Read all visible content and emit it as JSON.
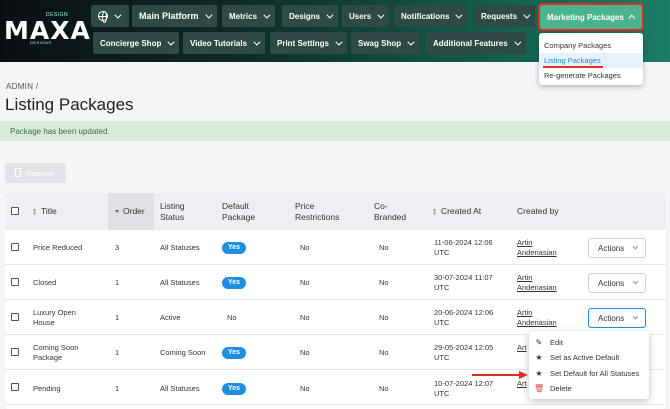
{
  "header": {
    "logo": "MAXA",
    "logo_small_top": "DESIGN",
    "logo_small_bottom": "DESIGNS",
    "nav_row1": [
      {
        "label": "Main Platform"
      },
      {
        "label": "Metrics"
      },
      {
        "label": "Designs"
      },
      {
        "label": "Users"
      },
      {
        "label": "Notifications"
      },
      {
        "label": "Requests"
      },
      {
        "label": "Marketing Packages"
      }
    ],
    "nav_row2": [
      {
        "label": "Concierge Shop"
      },
      {
        "label": "Video Tutorials"
      },
      {
        "label": "Print Settings"
      },
      {
        "label": "Swag Shop"
      },
      {
        "label": "Additional Features"
      }
    ],
    "marketing_menu": [
      "Company Packages",
      "Listing Packages",
      "Re-generate Packages"
    ]
  },
  "breadcrumb": "ADMIN /",
  "page_title": "Listing Packages",
  "alert": "Package has been updated.",
  "remove_label": "Remove",
  "table": {
    "columns": {
      "title": "Title",
      "order": "Order",
      "listing_status": "Listing Status",
      "default_package": "Default Package",
      "price_restrictions": "Price Restrictions",
      "co_branded": "Co-Branded",
      "created_at": "Created At",
      "created_by": "Created by"
    },
    "rows": [
      {
        "title": "Price Reduced",
        "order": "3",
        "status": "All Statuses",
        "default": "Yes",
        "price": "No",
        "cobranded": "No",
        "created_at": "11-06-2024 12:06 UTC",
        "created_by": "Artin Anderiasian"
      },
      {
        "title": "Closed",
        "order": "1",
        "status": "All Statuses",
        "default": "Yes",
        "price": "No",
        "cobranded": "No",
        "created_at": "30-07-2024 11:07 UTC",
        "created_by": "Artin Anderiasian"
      },
      {
        "title": "Luxury Open House",
        "order": "1",
        "status": "Active",
        "default": "No",
        "price": "No",
        "cobranded": "No",
        "created_at": "20-06-2024 12:06 UTC",
        "created_by": "Artin Anderiasian"
      },
      {
        "title": "Coming Soon Package",
        "order": "1",
        "status": "Coming Soon",
        "default": "Yes",
        "price": "No",
        "cobranded": "No",
        "created_at": "29-05-2024 12:05 UTC",
        "created_by": "Art"
      },
      {
        "title": "Pending",
        "order": "1",
        "status": "All Statuses",
        "default": "Yes",
        "price": "No",
        "cobranded": "No",
        "created_at": "10-07-2024 12:07 UTC",
        "created_by": "Art"
      }
    ],
    "actions_label": "Actions"
  },
  "actions_menu": [
    {
      "label": "Edit",
      "icon": "pencil-icon"
    },
    {
      "label": "Set as Active Default",
      "icon": "star-icon"
    },
    {
      "label": "Set Default for All Statuses",
      "icon": "star-icon"
    },
    {
      "label": "Delete",
      "icon": "trash-icon"
    }
  ],
  "colors": {
    "accent": "#1e8fe0",
    "highlight": "#e02b20",
    "nav_active": "#4bb38f"
  }
}
